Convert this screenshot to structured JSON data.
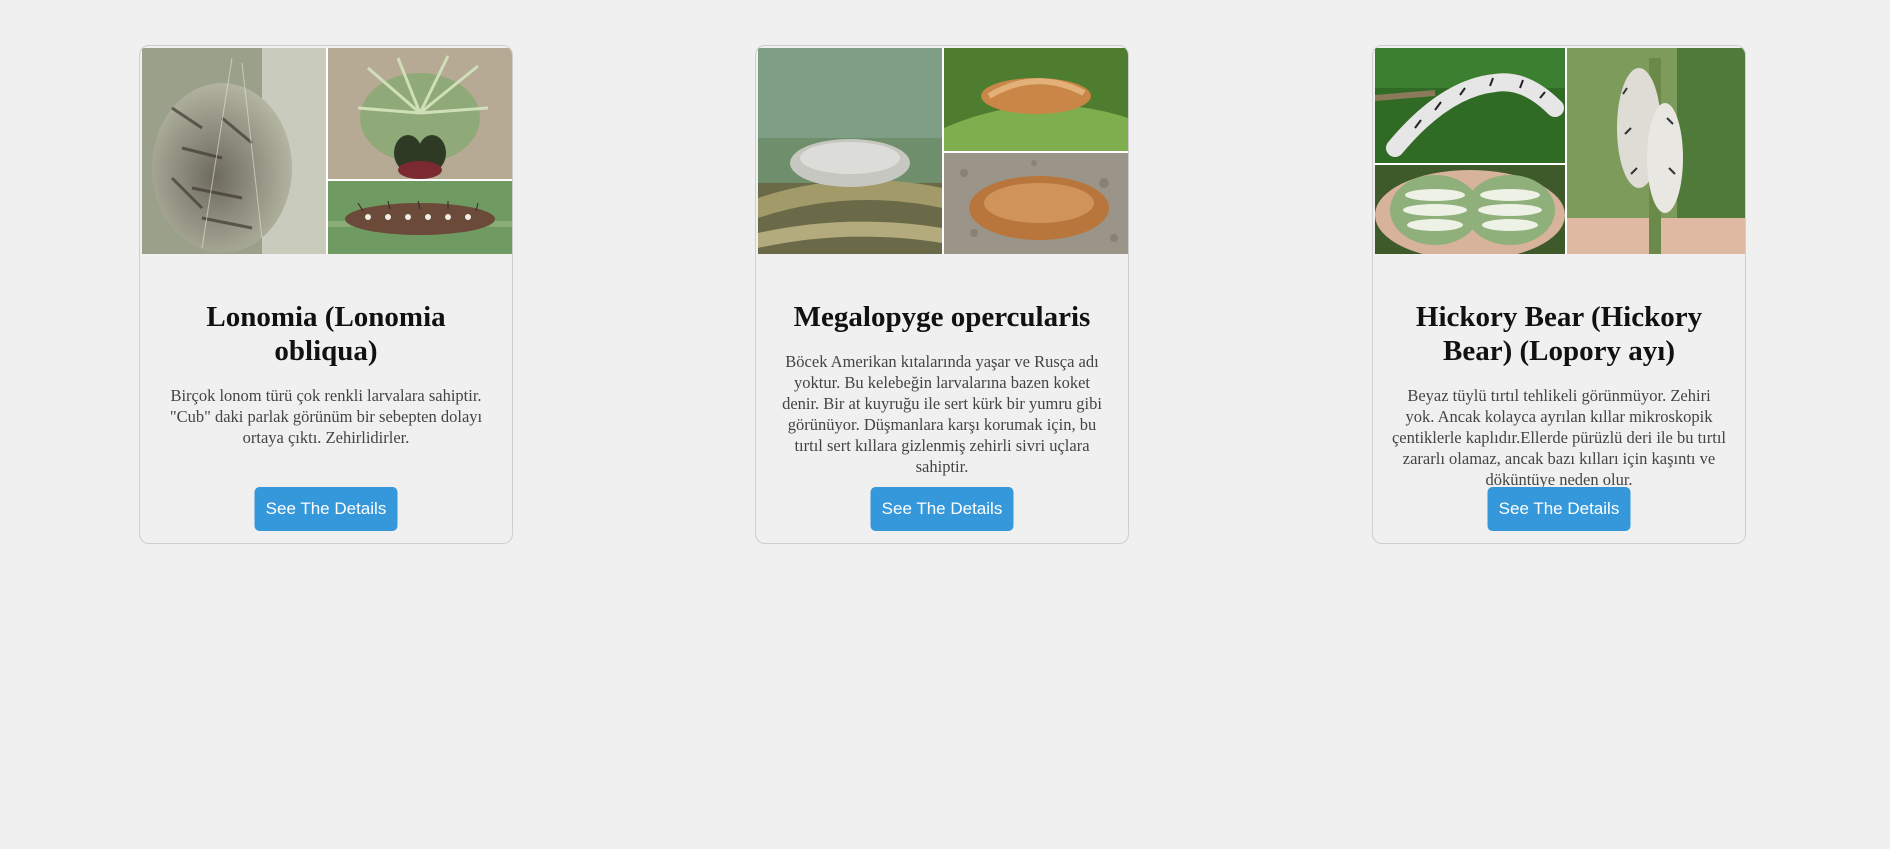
{
  "cards": [
    {
      "title": "Lonomia (Lonomia obliqua)",
      "description": "Birçok lonom türü çok renkli larvalara sahiptir. \"Cub\" daki parlak görünüm bir sebepten dolayı ortaya çıktı. Zehirlidirler.",
      "button_label": "See The Details",
      "image_alt": "Lonomia caterpillars collage"
    },
    {
      "title": "Megalopyge opercularis",
      "description": "Böcek Amerikan kıtalarında yaşar ve Rusça adı yoktur. Bu kelebeğin larvalarına bazen koket denir. Bir at kuyruğu ile sert kürk bir yumru gibi görünüyor. Düşmanlara karşı korumak için, bu tırtıl sert kıllara gizlenmiş zehirli sivri uçlara sahiptir.",
      "button_label": "See The Details",
      "image_alt": "Megalopyge opercularis caterpillars collage"
    },
    {
      "title": "Hickory Bear (Hickory Bear) (Lopory ayı)",
      "description": "Beyaz tüylü tırtıl tehlikeli görünmüyor. Zehiri yok. Ancak kolayca ayrılan kıllar mikroskopik çentiklerle kaplıdır.Ellerde pürüzlü deri ile bu tırtıl zararlı olamaz, ancak bazı kılları için kaşıntı ve döküntüye neden olur.",
      "button_label": "See The Details",
      "image_alt": "Hickory bear caterpillars collage"
    }
  ]
}
